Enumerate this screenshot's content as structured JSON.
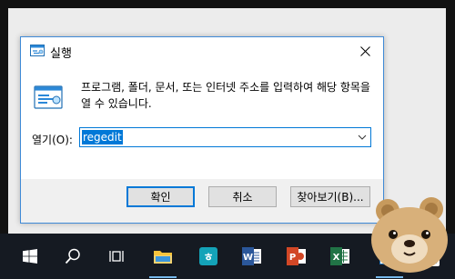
{
  "dialog": {
    "title": "실행",
    "description": "프로그램, 폴더, 문서, 또는 인터넷 주소를 입력하여 해당 항목을 열 수 있습니다.",
    "open_label": "열기(O):",
    "input_value": "regedit",
    "buttons": {
      "ok": "확인",
      "cancel": "취소",
      "browse": "찾아보기(B)..."
    },
    "close_icon": "close-icon",
    "accent_color": "#0078d7"
  },
  "taskbar": {
    "items": [
      {
        "name": "start-windows-icon"
      },
      {
        "name": "search-icon"
      },
      {
        "name": "task-view-icon"
      },
      {
        "name": "file-explorer-icon",
        "active": true
      },
      {
        "name": "hangul-word-icon"
      },
      {
        "name": "word-icon"
      },
      {
        "name": "powerpoint-icon"
      },
      {
        "name": "excel-icon"
      },
      {
        "name": "run-window-icon",
        "active": true
      }
    ],
    "color": "#151a22"
  }
}
